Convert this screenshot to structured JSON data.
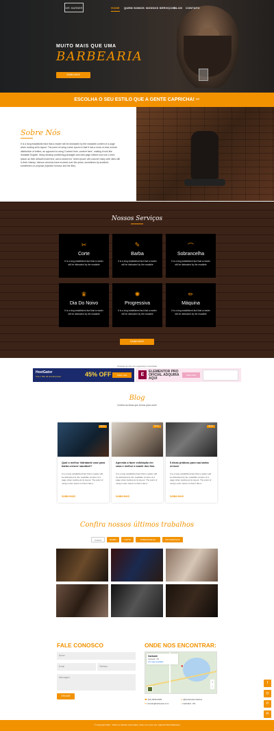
{
  "header": {
    "logo": "MR. BARBER",
    "nav": [
      "HOME",
      "QUEM SOMOS",
      "NOSSOS SERVIÇOS",
      "BLOG",
      "CONTATO"
    ]
  },
  "hero": {
    "small": "MUITO MAIS QUE UMA",
    "big": "BARBEARIA",
    "button": "SAIBA MAIS"
  },
  "strip": {
    "text": "ESCOLHA O SEU ESTILO QUE A GENTE CAPRICHA!"
  },
  "about": {
    "title": "Sobre Nós",
    "text": "It is a long established fact that a reader will be distracted by the readable content of a page when looking at its layout. The point of using Lorem Ipsum is that it has a more-or-less normal distribution of letters, as opposed to using 'Content here, content here', making it look like readable English. Many desktop publishing packages and web page editors now use Lorem Ipsum as their default model text, and a search for 'lorem ipsum' will uncover many web sites still in their infancy. Various versions have evolved over the years, sometimes by accident, sometimes on purpose (injected humour and the like)."
  },
  "services": {
    "title": "Nossos Serviços",
    "button": "SAIBA MAIS",
    "items": [
      {
        "title": "Corte",
        "icon": "scissors-icon",
        "glyph": "✂",
        "desc": "It is a long established fact that a reader will be distracted by the readable"
      },
      {
        "title": "Barba",
        "icon": "beard-icon",
        "glyph": "✎",
        "desc": "It is a long established fact that a reader will be distracted by the readable"
      },
      {
        "title": "Sobrancelha",
        "icon": "eyebrow-icon",
        "glyph": "⌒",
        "desc": "It is a long established fact that a reader will be distracted by the readable"
      },
      {
        "title": "Dia Do Noivo",
        "icon": "tie-icon",
        "glyph": "♛",
        "desc": "It is a long established fact that a reader will be distracted by the readable"
      },
      {
        "title": "Progressiva",
        "icon": "hair-dryer-icon",
        "glyph": "✺",
        "desc": "It is a long established fact that a reader will be distracted by the readable"
      },
      {
        "title": "Máquina",
        "icon": "clipper-icon",
        "glyph": "✏",
        "desc": "It is a long established fact that a reader will be distracted by the readable"
      }
    ]
  },
  "ads": {
    "caption": "Hospede seu site com segurança e velocidade",
    "ad1": {
      "brand": "HostGator",
      "sub": "Crie o Site da sua Empresa",
      "pct": "45% OFF",
      "btn": "Saiba mais"
    },
    "ad2": {
      "logo": "E",
      "title": "ELEMENTOR PRO OFICIAL ADQUIRA AQUI",
      "btn": "Saiba Mais"
    }
  },
  "blog": {
    "title": "Blog",
    "subtitle": "Confira as dicas que temos para você!",
    "more": "SAIBA MAIS",
    "tag": "BLOG",
    "posts": [
      {
        "title": "Qual o melhor hidratante usar para barba crescer saudável?",
        "desc": "It is a long established fact that a reader will be distracted by the readable content of a page when looking at its layout. The point of using Lorem Ipsum is that it has a"
      },
      {
        "title": "Aprenda a fazer esfoliação em casa e melhor a saúde dos fios.",
        "desc": "It is a long established fact that a reader will be distracted by the readable content of a page when looking at its layout. The point of using Lorem Ipsum is that it has a"
      },
      {
        "title": "5 dicas práticas para sua barba crescer",
        "desc": "It is a long established fact that a reader will be distracted by the readable content of a page when looking at its layout. The point of using Lorem Ipsum is that it has a"
      }
    ]
  },
  "works": {
    "title": "Confira nossos últimos trabalhos",
    "filters": [
      "TODOS",
      "BARBA",
      "CORTE",
      "SOBRANCELHA",
      "PROGRESSIVA"
    ]
  },
  "contact": {
    "title": "FALE CONOSCO",
    "name_ph": "Nome",
    "email_ph": "Email",
    "phone_ph": "Telefone",
    "msg_ph": "Mensagem",
    "send": "ENVIAR"
  },
  "location": {
    "title": "ONDE NOS ENCONTRAR:",
    "map_place": "Garibaldi",
    "map_sub": "Garibaldi - RS",
    "map_link": "Ver mapa ampliado",
    "phone1": "(54) 9999-9999",
    "email1": "contato@barbearia.com",
    "phone2": "@barbeariamrbarber",
    "email2": "Garibaldi - RS"
  },
  "footer": {
    "text": "© Copyright 2022 - Todos os direitos reservados. Feito com amor por: Agência Web Marketing"
  },
  "social": [
    "facebook-icon",
    "instagram-icon",
    "whatsapp-icon",
    "email-icon",
    "linkedin-icon"
  ]
}
